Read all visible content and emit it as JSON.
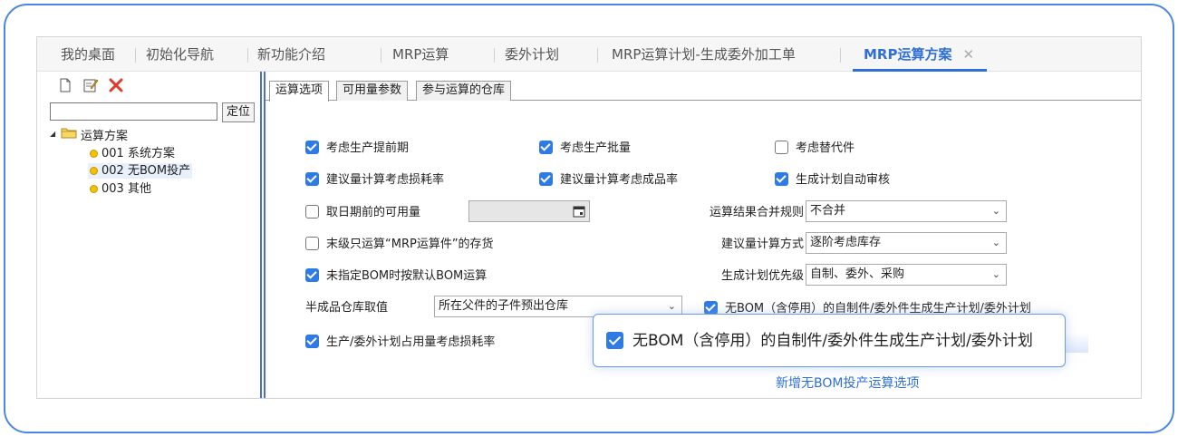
{
  "tabs": [
    {
      "label": "我的桌面"
    },
    {
      "label": "初始化导航"
    },
    {
      "label": "新功能介绍"
    },
    {
      "label": "MRP运算"
    },
    {
      "label": "委外计划"
    },
    {
      "label": "MRP运算计划-生成委外加工单"
    },
    {
      "label": "MRP运算方案",
      "active": true,
      "close": "✕"
    }
  ],
  "left_panel": {
    "search_placeholder": "",
    "locate_button": "定位",
    "tree": {
      "root": "运算方案",
      "items": [
        "001 系统方案",
        "002 无BOM投产",
        "003 其他"
      ],
      "selected_index": 1
    }
  },
  "subtabs": [
    "运算选项",
    "可用量参数",
    "参与运算的仓库"
  ],
  "options": {
    "consider_lead_time": {
      "label": "考虑生产提前期",
      "checked": true
    },
    "consider_batch": {
      "label": "考虑生产批量",
      "checked": true
    },
    "consider_substitute": {
      "label": "考虑替代件",
      "checked": false
    },
    "suggest_loss_rate": {
      "label": "建议量计算考虑损耗率",
      "checked": true
    },
    "suggest_yield_rate": {
      "label": "建议量计算考虑成品率",
      "checked": true
    },
    "auto_audit": {
      "label": "生成计划自动审核",
      "checked": true
    },
    "before_date_available": {
      "label": "取日期前的可用量",
      "checked": false,
      "date_value": ""
    },
    "last_level_mrp_only": {
      "label": "末级只运算“MRP运算件”的存货",
      "checked": false
    },
    "default_bom": {
      "label": "未指定BOM时按默认BOM运算",
      "checked": true
    },
    "plan_loss_rate": {
      "label": "生产/委外计划占用量考虑损耗率",
      "checked": true
    },
    "no_bom_plan": {
      "label": "无BOM（含停用）的自制件/委外件生成生产计划/委外计划",
      "checked": true
    }
  },
  "selects": {
    "merge_rule": {
      "label": "运算结果合并规则",
      "value": "不合并"
    },
    "suggest_method": {
      "label": "建议量计算方式",
      "value": "逐阶考虑库存"
    },
    "plan_priority": {
      "label": "生成计划优先级",
      "value": "自制、委外、采购"
    },
    "semi_warehouse": {
      "label": "半成品仓库取值",
      "value": "所在父件的子件预出仓库"
    }
  },
  "callout": {
    "label": "无BOM（含停用）的自制件/委外件生成生产计划/委外计划",
    "checked": true,
    "note": "新增无BOM投产运算选项"
  },
  "colors": {
    "accent": "#2f6fd6",
    "checkbox": "#2f7be6",
    "frame": "#4a86e8",
    "divider": "#4a6fd0"
  }
}
